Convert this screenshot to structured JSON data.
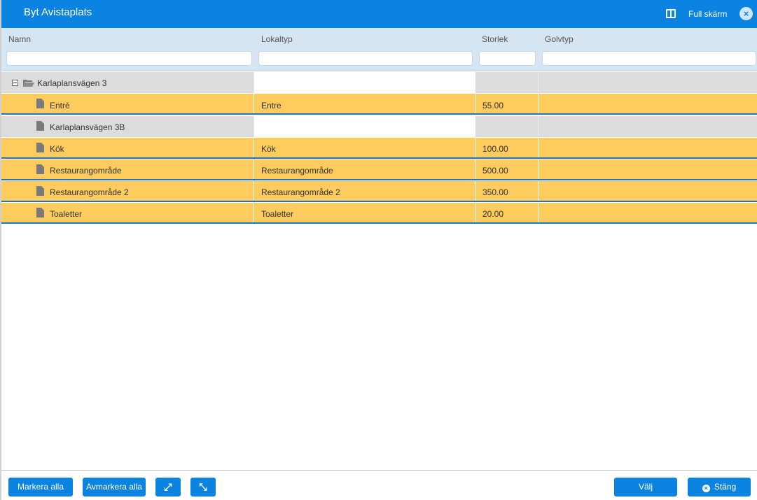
{
  "header": {
    "title": "Byt Avistaplats",
    "fullscreen_label": "Full skärm",
    "close_symbol": "×"
  },
  "columns": {
    "name": "Namn",
    "lokaltyp": "Lokaltyp",
    "storlek": "Storlek",
    "golvtyp": "Golvtyp"
  },
  "tree": {
    "root": {
      "name": "Karlaplansvägen 3",
      "expanded": true
    },
    "rows": [
      {
        "name": "Entrè",
        "lokaltyp": "Entre",
        "storlek": "55.00",
        "golvtyp": "",
        "selected": true
      },
      {
        "name": "Karlaplansvägen 3B",
        "lokaltyp": "",
        "storlek": "",
        "golvtyp": "",
        "selected": false
      },
      {
        "name": "Kök",
        "lokaltyp": "Kök",
        "storlek": "100.00",
        "golvtyp": "",
        "selected": true
      },
      {
        "name": "Restaurangområde",
        "lokaltyp": "Restaurangområde",
        "storlek": "500.00",
        "golvtyp": "",
        "selected": true
      },
      {
        "name": "Restaurangområde 2",
        "lokaltyp": "Restaurangområde 2",
        "storlek": "350.00",
        "golvtyp": "",
        "selected": true
      },
      {
        "name": "Toaletter",
        "lokaltyp": "Toaletter",
        "storlek": "20.00",
        "golvtyp": "",
        "selected": true
      }
    ]
  },
  "footer": {
    "select_all": "Markera alla",
    "deselect_all": "Avmarkera alla",
    "choose": "Välj",
    "close": "Stäng",
    "expand_symbol": "⤢",
    "collapse_symbol": "⤡",
    "close_symbol": "×"
  },
  "colors": {
    "accent": "#0a84e0",
    "selected_row": "#fdcb5e",
    "unselected_row": "#dcdcdc",
    "header_bg": "#d6e5f2"
  }
}
